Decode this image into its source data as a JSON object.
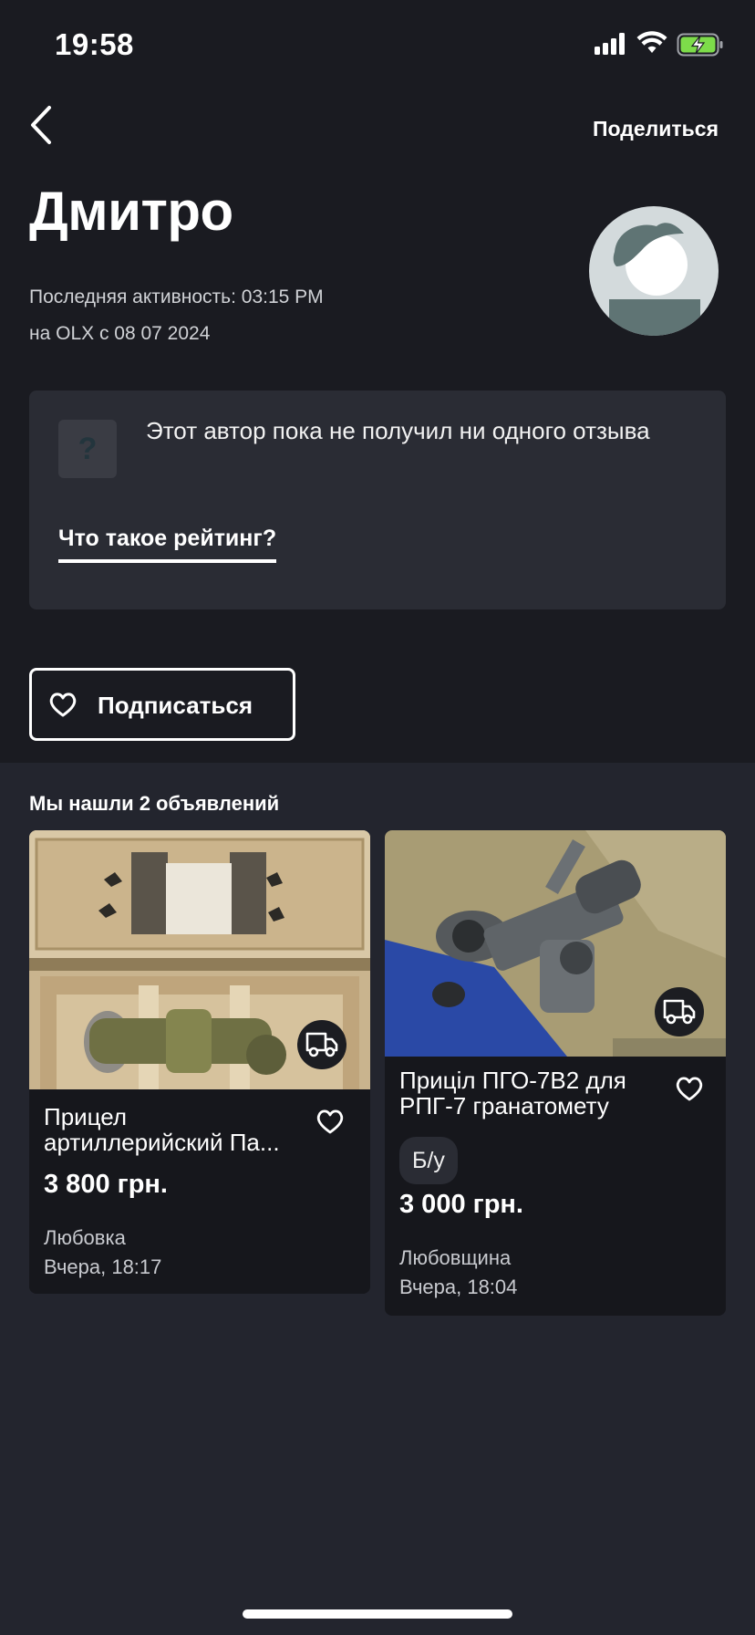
{
  "status_bar": {
    "time": "19:58"
  },
  "header": {
    "share_label": "Поделиться"
  },
  "profile": {
    "name": "Дмитро",
    "last_activity": "Последняя активность: 03:15 PM",
    "member_since": "на OLX с 08 07 2024"
  },
  "rating": {
    "icon_glyph": "?",
    "text": "Этот автор пока не получил ни одного отзыва",
    "link_label": "Что такое рейтинг?"
  },
  "subscribe": {
    "label": "Подписаться"
  },
  "listings": {
    "heading": "Мы нашли 2 объявлений",
    "items": [
      {
        "title": "Прицел артиллерийский Па...",
        "price": "3 800 грн.",
        "location": "Любовка",
        "date": "Вчера, 18:17",
        "delivery_icon": "truck-icon"
      },
      {
        "title": "Приціл ПГО-7В2 для РПГ-7 гранатомету",
        "condition": "Б/у",
        "price": "3 000 грн.",
        "location": "Любовщина",
        "date": "Вчера, 18:04",
        "delivery_icon": "truck-icon"
      }
    ]
  },
  "colors": {
    "background": "#23252e",
    "header_background": "#1a1b21",
    "card_background": "#16171c",
    "rating_card": "#2a2c34",
    "battery_charging": "#7ddc4a"
  }
}
